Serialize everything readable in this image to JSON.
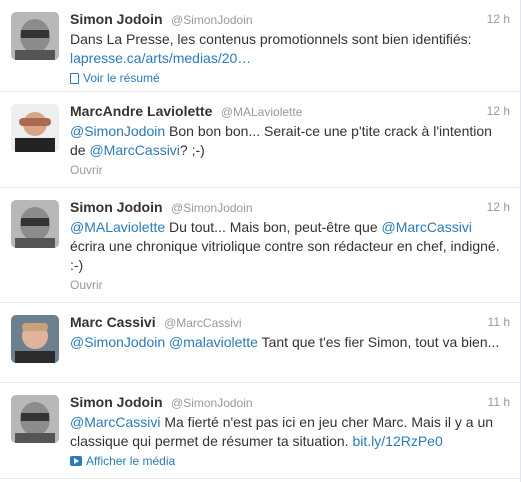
{
  "tweets": [
    {
      "name": "Simon Jodoin",
      "handle": "@SimonJodoin",
      "time": "12 h",
      "text_plain": "Dans La Presse, les contenus promotionnels sont bien identifiés:",
      "link": "lapresse.ca/arts/medias/20…",
      "action": "Voir le résumé",
      "action_icon": "document-icon"
    },
    {
      "name": "MarcAndre Laviolette",
      "handle": "@MALaviolette",
      "time": "12 h",
      "mention1": "@SimonJodoin",
      "text1": " Bon bon bon... Serait-ce une p'tite crack à l'intention de ",
      "mention2": "@MarcCassivi",
      "text2": "? ;-)",
      "action": "Ouvrir"
    },
    {
      "name": "Simon Jodoin",
      "handle": "@SimonJodoin",
      "time": "12 h",
      "mention1": "@MALaviolette",
      "text1": " Du tout... Mais bon, peut-être que ",
      "mention2": "@MarcCassivi",
      "text2": " écrira une chronique vitriolique contre son rédacteur en chef, indigné. :-)",
      "action": "Ouvrir"
    },
    {
      "name": "Marc Cassivi",
      "handle": "@MarcCassivi",
      "time": "11 h",
      "mention1": "@SimonJodoin",
      "mention2": "@malaviolette",
      "text1": " Tant que t'es fier Simon, tout va bien..."
    },
    {
      "name": "Simon Jodoin",
      "handle": "@SimonJodoin",
      "time": "11 h",
      "mention1": "@MarcCassivi",
      "text1": " Ma fierté n'est pas ici en jeu cher Marc. Mais il y a un classique qui permet de résumer ta situation. ",
      "link": "bit.ly/12RzPe0",
      "action": "Afficher le média",
      "action_icon": "play-icon"
    }
  ],
  "colors": {
    "link": "#2a7bb9",
    "meta": "#999999",
    "text": "#333333"
  }
}
